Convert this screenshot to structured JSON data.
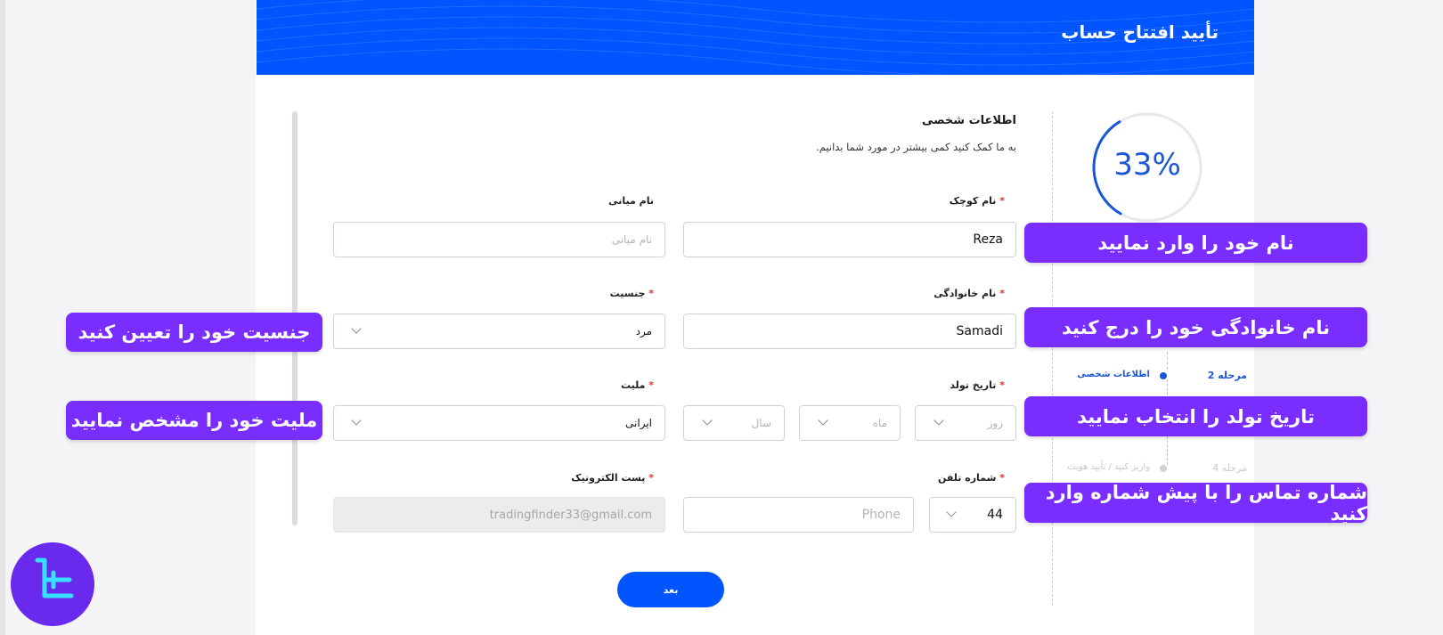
{
  "header": {
    "title": "تأیید افتتاح حساب"
  },
  "section": {
    "title": "اطلاعات شخصی",
    "subtitle": "به ما کمک کنید کمی بیشتر در مورد شما بدانیم."
  },
  "progress": {
    "percent_label": "33%",
    "value": 0.33
  },
  "form": {
    "first_name": {
      "label": "نام کوچک",
      "value": "Reza"
    },
    "middle_name": {
      "label": "نام میانی",
      "placeholder": "نام میانی"
    },
    "last_name": {
      "label": "نام خانوادگی",
      "value": "Samadi"
    },
    "gender": {
      "label": "جنسیت",
      "value": "مرد"
    },
    "birth_date": {
      "label": "تاریخ تولد",
      "day_placeholder": "روز",
      "month_placeholder": "ماه",
      "year_placeholder": "سال"
    },
    "nationality": {
      "label": "ملیت",
      "value": "ایرانی"
    },
    "phone": {
      "label": "شماره تلفن",
      "code": "44",
      "placeholder": "Phone"
    },
    "email": {
      "label": "پست الکترونیک",
      "value": "tradingfinder33@gmail.com"
    },
    "required_mark": "*"
  },
  "steps": [
    {
      "number": "مرحله 2",
      "title": "اطلاعات شخصی"
    },
    {
      "number": "مرحله 4",
      "title": "واریز کنید / تأیید هویت"
    }
  ],
  "next_button": {
    "label": "بعد"
  },
  "callouts": {
    "first_name": "نام خود را وارد نمایید",
    "last_name": "نام خانوادگی خود را درج کنید",
    "gender": "جنسیت خود را تعیین کنید",
    "birth_date": "تاریخ تولد را انتخاب نمایید",
    "nationality": "ملیت خود را مشخص نمایید",
    "phone": "شماره تماس را با پیش شماره وارد کنید"
  },
  "colors": {
    "brand": "#0055ff",
    "callout": "#7a2dff",
    "required": "#e0322b",
    "logo_bg": "#6a2aee",
    "logo_mark": "#35e0ff"
  }
}
